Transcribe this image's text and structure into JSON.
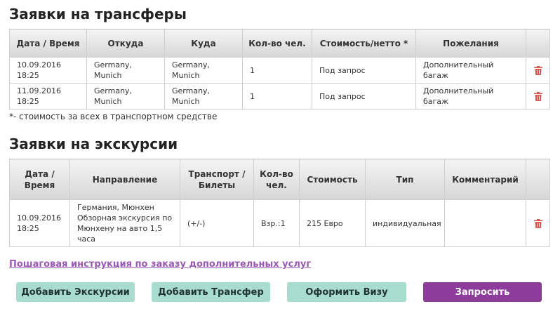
{
  "transfers": {
    "title": "Заявки на трансферы",
    "headers": [
      "Дата / Время",
      "Откуда",
      "Куда",
      "Кол-во чел.",
      "Стоимость/нетто *",
      "Пожелания"
    ],
    "rows": [
      {
        "date": "10.09.2016",
        "time": "18:25",
        "from": "Germany, Munich",
        "to": "Germany, Munich",
        "count": "1",
        "price": "Под запрос",
        "wishes": "Дополнительный багаж"
      },
      {
        "date": "11.09.2016",
        "time": "18:25",
        "from": "Germany, Munich",
        "to": "Germany, Munich",
        "count": "1",
        "price": "Под запрос",
        "wishes": "Дополнительный багаж"
      }
    ],
    "note": "*- стоимость за всех в транспортном средстве"
  },
  "excursions": {
    "title": "Заявки на экскурсии",
    "headers": [
      "Дата / Время",
      "Направление",
      "Транспорт / Билеты",
      "Кол-во чел.",
      "Стоимость",
      "Тип",
      "Комментарий"
    ],
    "rows": [
      {
        "date": "10.09.2016",
        "time": "18:25",
        "direction": "Германия, Мюнхен Обзорная экскурсия по Мюнхену на авто 1,5 часа",
        "transport": "(+/-)",
        "count": "Взр.:1",
        "price": "215 Евро",
        "type": "индивидуальная",
        "comment": ""
      }
    ]
  },
  "links": {
    "instructions": "Пошаговая инструкция по заказу дополнительных услуг"
  },
  "buttons": {
    "add_excursion": "Добавить Экскурсии",
    "add_transfer": "Добавить Трансфер",
    "visa": "Оформить Визу",
    "request": "Запросить"
  },
  "icons": {
    "delete": "trash-icon"
  },
  "colors": {
    "accent_purple": "#8d3c9b",
    "button_teal": "#a7dccf",
    "link": "#9b59b6",
    "delete_icon": "#d9534f"
  }
}
